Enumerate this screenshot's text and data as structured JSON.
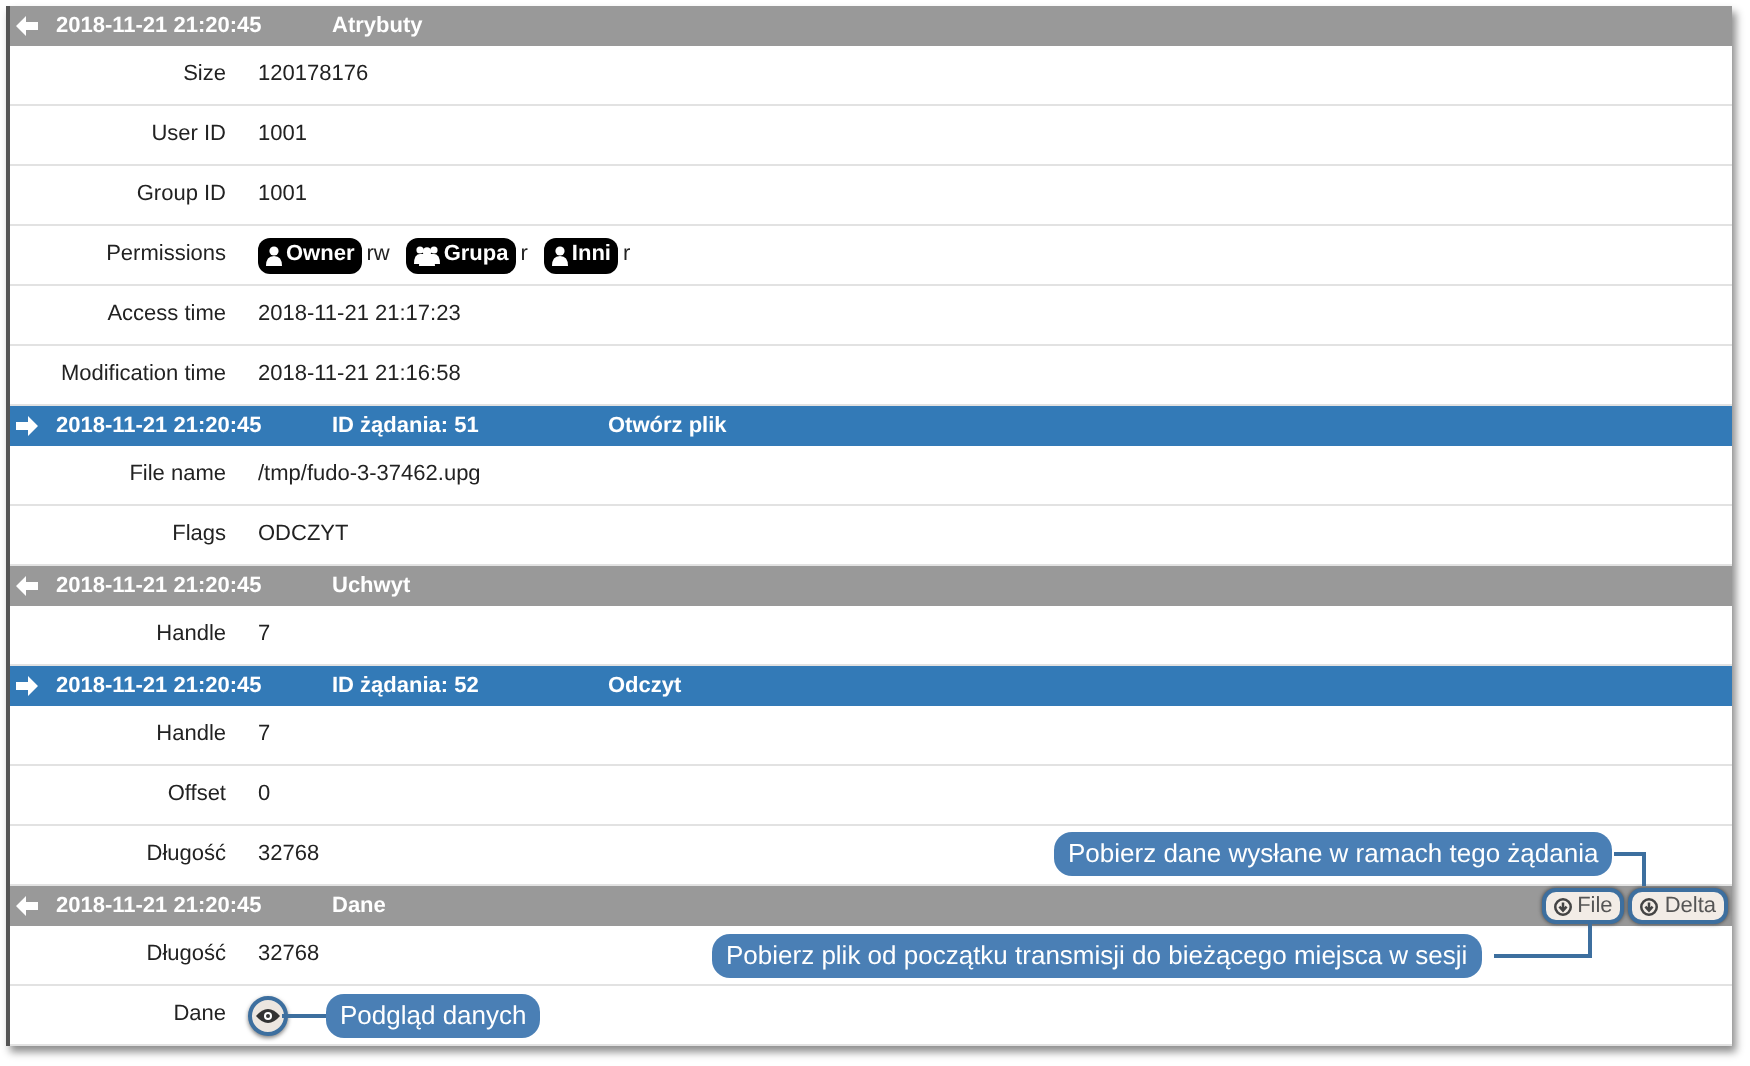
{
  "sections": [
    {
      "kind": "response",
      "timestamp": "2018-11-21 21:20:45",
      "columns": [
        "Atrybuty"
      ],
      "rows": [
        {
          "label": "Size",
          "kind": "text",
          "value": "120178176"
        },
        {
          "label": "User ID",
          "kind": "text",
          "value": "1001"
        },
        {
          "label": "Group ID",
          "kind": "text",
          "value": "1001"
        },
        {
          "label": "Permissions",
          "kind": "permissions",
          "permissions": [
            {
              "kind": "user",
              "label": "Owner",
              "rights": "rw"
            },
            {
              "kind": "group",
              "label": "Grupa",
              "rights": "r"
            },
            {
              "kind": "user",
              "label": "Inni",
              "rights": "r"
            }
          ]
        },
        {
          "label": "Access time",
          "kind": "text",
          "value": "2018-11-21 21:17:23"
        },
        {
          "label": "Modification time",
          "kind": "text",
          "value": "2018-11-21 21:16:58"
        }
      ]
    },
    {
      "kind": "request",
      "timestamp": "2018-11-21 21:20:45",
      "columns": [
        "ID żądania: 51",
        "Otwórz plik"
      ],
      "rows": [
        {
          "label": "File name",
          "kind": "text",
          "value": "/tmp/fudo-3-37462.upg"
        },
        {
          "label": "Flags",
          "kind": "text",
          "value": "ODCZYT"
        }
      ]
    },
    {
      "kind": "response",
      "timestamp": "2018-11-21 21:20:45",
      "columns": [
        "Uchwyt"
      ],
      "rows": [
        {
          "label": "Handle",
          "kind": "text",
          "value": "7"
        }
      ]
    },
    {
      "kind": "request",
      "timestamp": "2018-11-21 21:20:45",
      "columns": [
        "ID żądania: 52",
        "Odczyt"
      ],
      "rows": [
        {
          "label": "Handle",
          "kind": "text",
          "value": "7"
        },
        {
          "label": "Offset",
          "kind": "text",
          "value": "0"
        },
        {
          "label": "Długość",
          "kind": "text",
          "value": "32768"
        }
      ]
    },
    {
      "kind": "response",
      "timestamp": "2018-11-21 21:20:45",
      "columns": [
        "Dane"
      ],
      "buttons": [
        {
          "label": "File"
        },
        {
          "label": "Delta"
        }
      ],
      "rows": [
        {
          "label": "Długość",
          "kind": "text",
          "value": "32768"
        },
        {
          "label": "Dane",
          "kind": "view_button"
        }
      ]
    }
  ],
  "callouts": [
    {
      "text": "Pobierz dane wysłane w ramach tego żądania"
    },
    {
      "text": "Pobierz plik od początku transmisji do bieżącego miejsca w sesji"
    },
    {
      "text": "Podgląd danych"
    }
  ]
}
